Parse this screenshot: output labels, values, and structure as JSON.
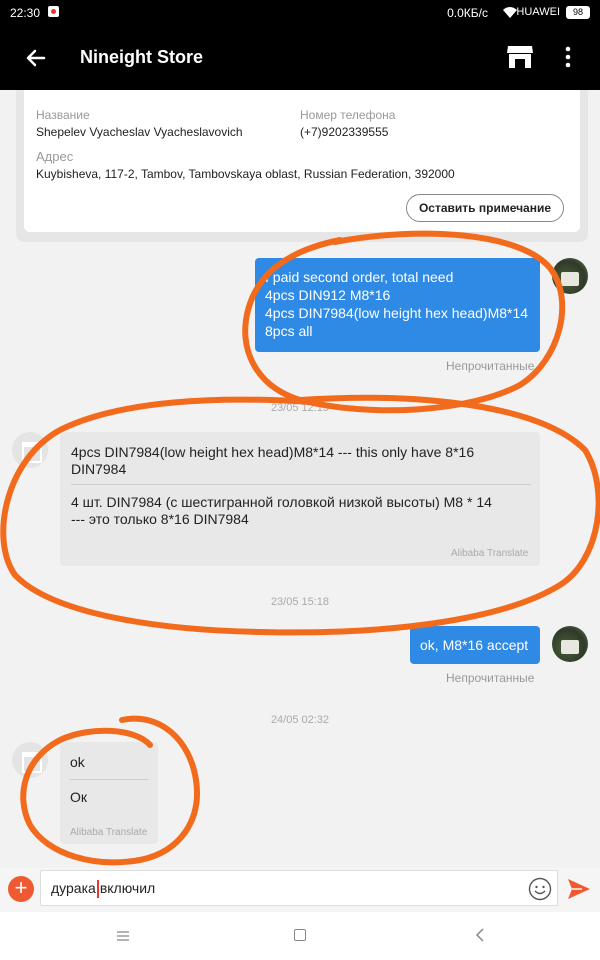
{
  "status_bar": {
    "time": "22:30",
    "speed": "0.0КБ/с",
    "carrier": "HUAWEI",
    "battery": "98"
  },
  "app_bar": {
    "title": "Nineight Store",
    "back_icon": "arrow-left-icon",
    "store_icon": "store-icon",
    "more_icon": "more-vert-icon"
  },
  "address_card": {
    "name_label": "Название",
    "name_value": "Shepelev Vyacheslav Vyacheslavovich",
    "phone_label": "Номер телефона",
    "phone_value": "(+7)9202339555",
    "address_label": "Адрес",
    "address_value": "Kuybisheva, 117-2, Tambov, Tambovskaya oblast, Russian Federation, 392000",
    "note_button": "Оставить примечание"
  },
  "messages": [
    {
      "direction": "outgoing",
      "lines": [
        "I paid second order, total need",
        "4pcs DIN912 M8*16",
        "4pcs DIN7984(low height hex head)M8*14",
        "8pcs all"
      ],
      "status": "Непрочитанные"
    },
    {
      "timestamp": "23/05 12:15"
    },
    {
      "direction": "incoming",
      "original_lines": [
        "4pcs DIN7984(low height hex head)M8*14  ---  this  only  have   8*16",
        "DIN7984"
      ],
      "translated_lines": [
        "4 шт. DIN7984 (с шестигранной головкой низкой высоты) M8 * 14",
        "--- это только 8*16 DIN7984"
      ],
      "translate_label": "Alibaba Translate"
    },
    {
      "timestamp": "23/05 15:18"
    },
    {
      "direction": "outgoing",
      "lines": [
        "ok, M8*16 accept"
      ],
      "status": "Непрочитанные"
    },
    {
      "timestamp": "24/05 02:32"
    },
    {
      "direction": "incoming",
      "original_lines": [
        "ok"
      ],
      "translated_lines": [
        "Ок"
      ],
      "translate_label": "Alibaba Translate"
    }
  ],
  "input_bar": {
    "text_before_caret": "дурака",
    "text_after_caret": "включил",
    "plus_icon": "plus-icon",
    "emoji_icon": "emoji-icon",
    "send_icon": "send-icon"
  },
  "nav_bar": {
    "menu_icon": "menu-icon",
    "home_icon": "home-icon",
    "back_icon": "back-icon"
  },
  "colors": {
    "outgoing_bubble": "#2f8ae5",
    "incoming_bubble": "#e8e8e8",
    "accent": "#ef5a33",
    "annotation": "#f26b1d"
  }
}
